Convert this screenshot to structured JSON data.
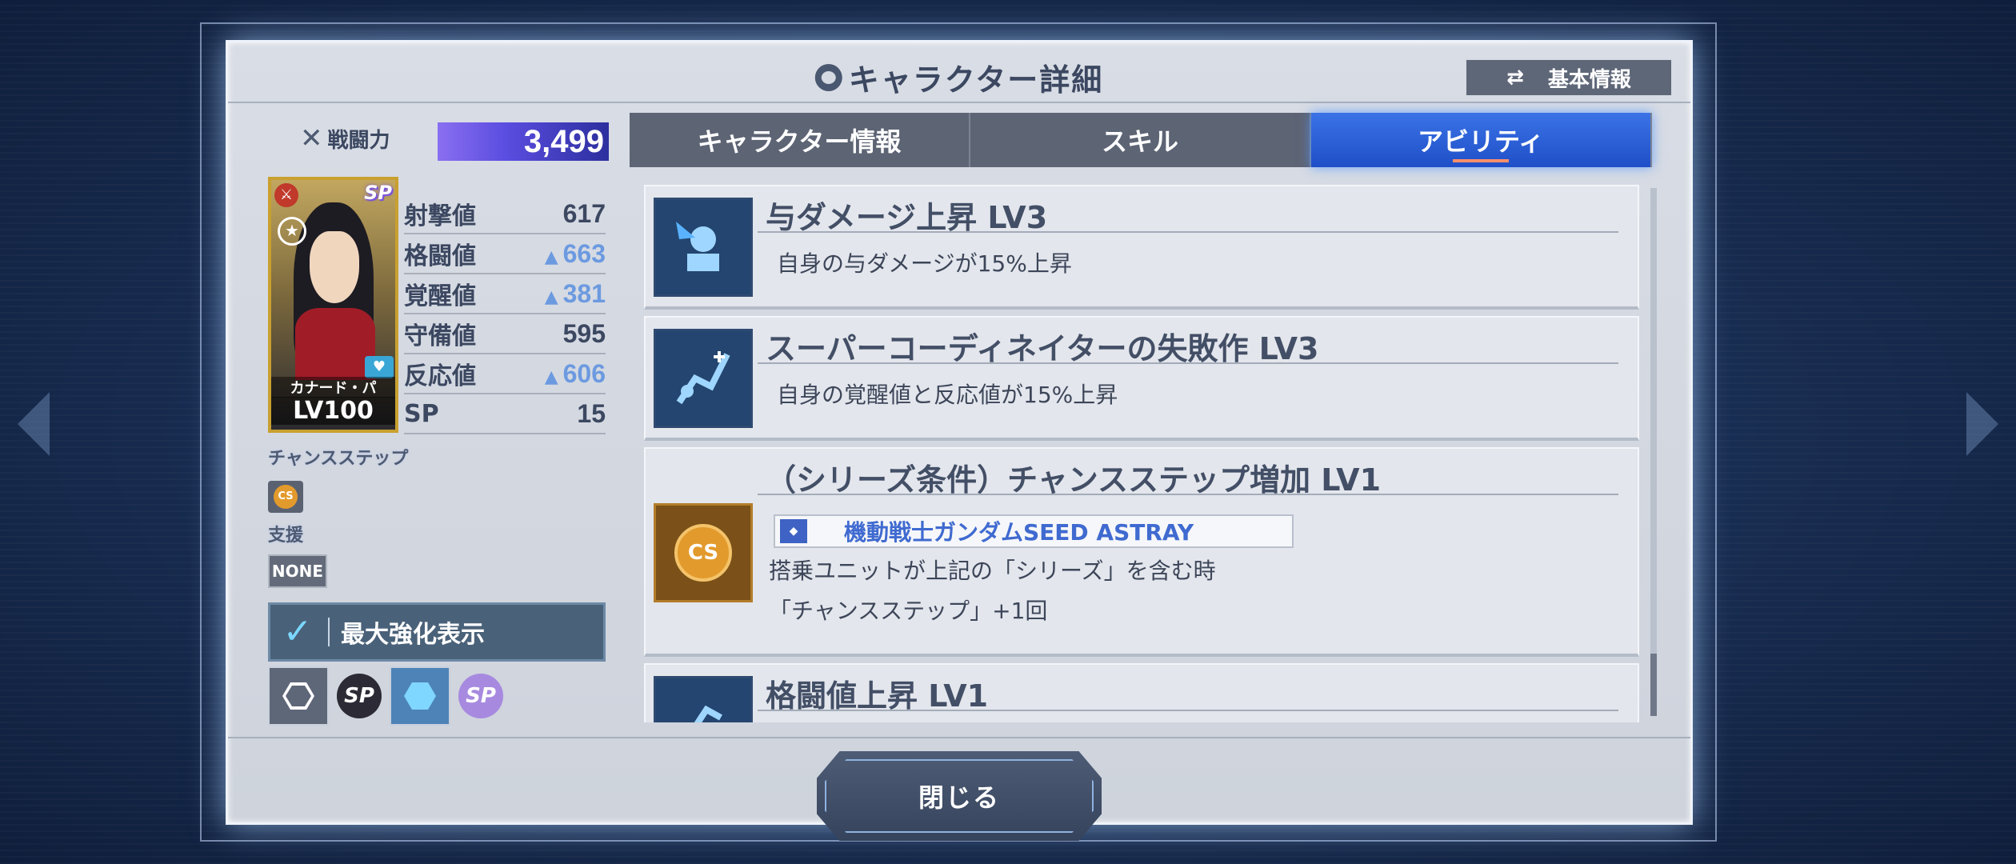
{
  "header": {
    "title": "キャラクター詳細",
    "basic_info_button": "基本情報"
  },
  "power": {
    "label": "戦闘力",
    "value": "3,499"
  },
  "character": {
    "name": "カナード・パ",
    "level": "LV100",
    "rarity_badge": "SP"
  },
  "stats": [
    {
      "label": "射撃値",
      "value": "617",
      "boosted": false
    },
    {
      "label": "格闘値",
      "value": "663",
      "boosted": true
    },
    {
      "label": "覚醒値",
      "value": "381",
      "boosted": true
    },
    {
      "label": "守備値",
      "value": "595",
      "boosted": false
    },
    {
      "label": "反応値",
      "value": "606",
      "boosted": true
    },
    {
      "label": "SP",
      "value": "15",
      "boosted": false
    }
  ],
  "chance_step": {
    "label": "チャンスステップ",
    "icon_text": "CS"
  },
  "support": {
    "label": "支援",
    "value": "NONE"
  },
  "max_enhance": {
    "label": "最大強化表示",
    "checked": true
  },
  "filters": [
    {
      "name": "hex-outline-icon",
      "active": false
    },
    {
      "name": "sp-dark-icon",
      "active": false
    },
    {
      "name": "hex-filled-icon",
      "active": true
    },
    {
      "name": "sp-color-icon",
      "active": false
    }
  ],
  "tabs": [
    {
      "label": "キャラクター情報",
      "active": false
    },
    {
      "label": "スキル",
      "active": false
    },
    {
      "label": "アビリティ",
      "active": true
    }
  ],
  "abilities": [
    {
      "title": "与ダメージ上昇 LV3",
      "desc": "自身の与ダメージが15%上昇"
    },
    {
      "title": "スーパーコーディネイターの失敗作 LV3",
      "desc": "自身の覚醒値と反応値が15%上昇"
    },
    {
      "title": "（シリーズ条件）チャンスステップ増加 LV1",
      "series": "機動戦士ガンダムSEED ASTRAY",
      "desc1": "搭乗ユニットが上記の「シリーズ」を含む時",
      "desc2": "「チャンスステップ」+1回",
      "icon_text": "CS"
    },
    {
      "title": "格闘値上昇 LV1"
    }
  ],
  "close_button": "閉じる",
  "colors": {
    "accent_blue": "#2a5fd6",
    "boost_blue": "#6c9ae0",
    "power_bar": "#5a4de0",
    "cs_orange": "#e39a2c"
  }
}
